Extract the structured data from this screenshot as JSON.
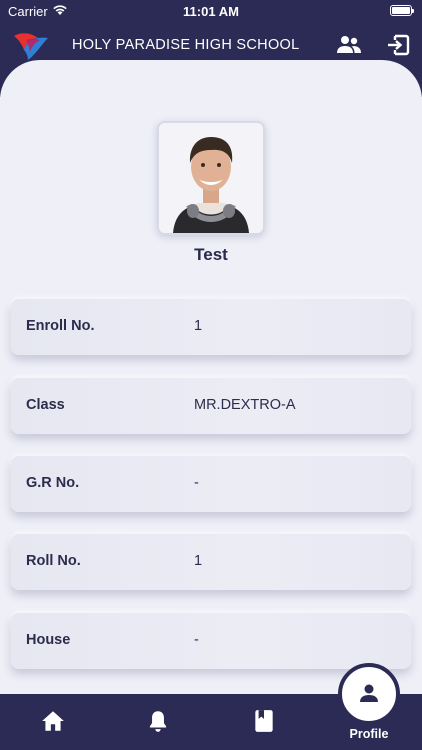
{
  "status_bar": {
    "carrier": "Carrier",
    "time": "11:01 AM"
  },
  "header": {
    "school_name": "HOLY PARADISE HIGH SCHOOL",
    "logo_icon": "school-logo",
    "actions": [
      {
        "icon": "users-icon"
      },
      {
        "icon": "logout-icon"
      }
    ],
    "background_color": "#2b2b55"
  },
  "profile": {
    "name": "Test",
    "photo_icon": "student-photo"
  },
  "details": [
    {
      "label": "Enroll No.",
      "value": "1"
    },
    {
      "label": "Class",
      "value": "MR.DEXTRO-A"
    },
    {
      "label": "G.R No.",
      "value": "-"
    },
    {
      "label": "Roll No.",
      "value": "1"
    },
    {
      "label": "House",
      "value": "-"
    }
  ],
  "bottom_nav": {
    "items": [
      {
        "icon": "home-icon"
      },
      {
        "icon": "bell-icon"
      },
      {
        "icon": "book-icon"
      },
      {
        "icon": "profile-icon",
        "label": "Profile",
        "active": true
      }
    ],
    "background_color": "#2b2b55"
  }
}
